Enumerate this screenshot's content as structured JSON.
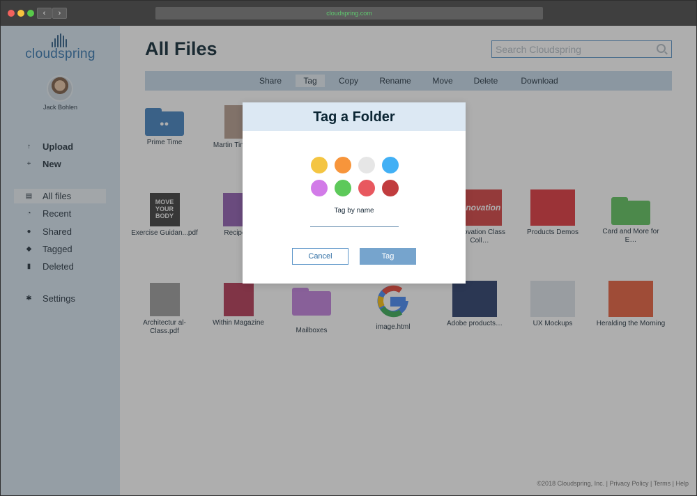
{
  "browser": {
    "url": "cloudspring.com",
    "back_label": "‹",
    "forward_label": "›"
  },
  "brand": {
    "name": "cloudspring",
    "color": "#2f72ac"
  },
  "user": {
    "name": "Jack Bohlen"
  },
  "sidebar": {
    "actions": [
      {
        "label": "Upload",
        "icon": "arrow-up-icon",
        "glyph": "↑"
      },
      {
        "label": "New",
        "icon": "plus-circle-icon",
        "glyph": "+"
      }
    ],
    "nav": [
      {
        "label": "All files",
        "icon": "files-icon",
        "glyph": "▤",
        "active": true
      },
      {
        "label": "Recent",
        "icon": "clock-icon",
        "glyph": "◔"
      },
      {
        "label": "Shared",
        "icon": "people-icon",
        "glyph": "●"
      },
      {
        "label": "Tagged",
        "icon": "tag-icon",
        "glyph": "◆"
      },
      {
        "label": "Deleted",
        "icon": "trash-icon",
        "glyph": "▮"
      }
    ],
    "settings": {
      "label": "Settings",
      "icon": "gear-icon",
      "glyph": "✱"
    }
  },
  "main": {
    "title": "All Files",
    "search_placeholder": "Search Cloudspring"
  },
  "toolbar": {
    "items": [
      "Share",
      "Tag",
      "Copy",
      "Rename",
      "Move",
      "Delete",
      "Download"
    ],
    "active": "Tag"
  },
  "files": [
    {
      "name": "Prime Time",
      "type": "folder",
      "color": "#3f7fbf"
    },
    {
      "name": "Martin Time-S…",
      "type": "doc",
      "color": "#b59b8c"
    },
    {
      "name": "Exercise Guidan...pdf",
      "type": "image",
      "color": "#3a3a3a",
      "thumb_text": "MOVE YOUR BODY"
    },
    {
      "name": "Recipe…",
      "type": "image",
      "color": "#8e5bb0"
    },
    {
      "name": "Innovation Class Coll…",
      "type": "image",
      "color": "#d43f3f",
      "thumb_text": "Innovation"
    },
    {
      "name": "Products Demos",
      "type": "image",
      "color": "#e0323a"
    },
    {
      "name": "Card and More for E…",
      "type": "folder",
      "color": "#5cc25a"
    },
    {
      "name": "Architectur al-Class.pdf",
      "type": "image",
      "color": "#9a9a9a"
    },
    {
      "name": "Within Magazine",
      "type": "image",
      "color": "#b23553"
    },
    {
      "name": "Mailboxes",
      "type": "folder",
      "color": "#c07ddc"
    },
    {
      "name": "image.html",
      "type": "google",
      "color": "#ffffff"
    },
    {
      "name": "Adobe products…",
      "type": "image",
      "color": "#253a68"
    },
    {
      "name": "UX Mockups",
      "type": "image",
      "color": "#dde3ea"
    },
    {
      "name": "Heralding the Morning",
      "type": "image",
      "color": "#e65d3a"
    }
  ],
  "modal": {
    "title": "Tag a Folder",
    "colors": [
      "#f4c542",
      "#f7953b",
      "#e6e6e6",
      "#42b0f5",
      "#d27be8",
      "#5dc95a",
      "#e8585f",
      "#c13c3e"
    ],
    "input_label": "Tag by name",
    "input_value": "",
    "cancel_label": "Cancel",
    "confirm_label": "Tag"
  },
  "footer": {
    "text": "©2018 Cloudspring, Inc. | Privacy Policy | Terms | Help"
  }
}
